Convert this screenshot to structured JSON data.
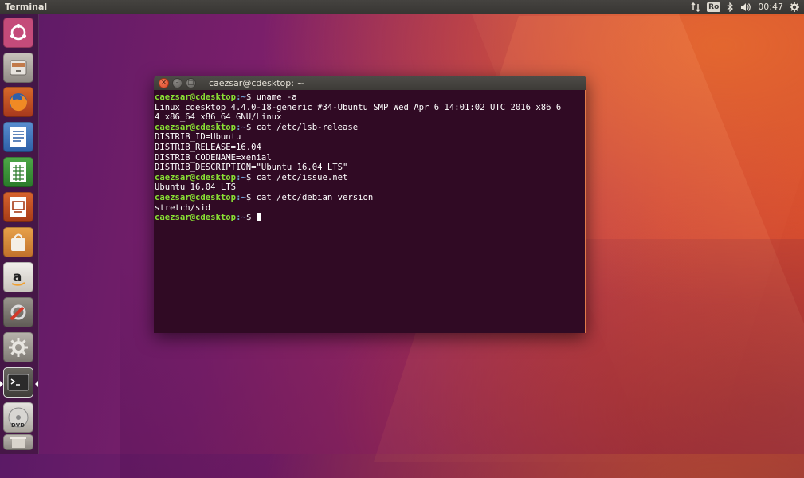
{
  "top_panel": {
    "app_title": "Terminal",
    "keyboard_layout": "Ro",
    "clock": "00:47"
  },
  "launcher": {
    "items": [
      {
        "name": "dash-home"
      },
      {
        "name": "files"
      },
      {
        "name": "firefox"
      },
      {
        "name": "libreoffice-writer"
      },
      {
        "name": "libreoffice-calc"
      },
      {
        "name": "libreoffice-impress"
      },
      {
        "name": "software-center"
      },
      {
        "name": "amazon"
      },
      {
        "name": "system-tools"
      },
      {
        "name": "system-settings"
      },
      {
        "name": "terminal"
      },
      {
        "name": "dvd"
      },
      {
        "name": "trash"
      }
    ]
  },
  "terminal": {
    "title": "caezsar@cdesktop: ~",
    "prompt_user": "caezsar@cdesktop",
    "prompt_path": ":~",
    "prompt_symbol": "$ ",
    "commands": [
      "uname -a",
      "cat /etc/lsb-release",
      "cat /etc/issue.net",
      "cat /etc/debian_version"
    ],
    "outputs": [
      "Linux cdesktop 4.4.0-18-generic #34-Ubuntu SMP Wed Apr 6 14:01:02 UTC 2016 x86_6",
      "4 x86_64 x86_64 GNU/Linux",
      "DISTRIB_ID=Ubuntu",
      "DISTRIB_RELEASE=16.04",
      "DISTRIB_CODENAME=xenial",
      "DISTRIB_DESCRIPTION=\"Ubuntu 16.04 LTS\"",
      "Ubuntu 16.04 LTS",
      "stretch/sid"
    ]
  },
  "colors": {
    "terminal_bg": "#300a24",
    "prompt_user": "#8ae234",
    "prompt_path": "#729fcf",
    "close_button": "#e0562f"
  }
}
